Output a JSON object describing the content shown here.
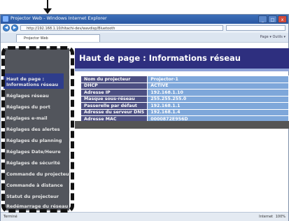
{
  "window": {
    "title": "Projector Web - Windows Internet Explorer",
    "url": "http://192.168.1.10/hitachi-dev/wavdisp/Bluetooth",
    "tab_label": "Projector Web",
    "toolbar_text": "Page ▾  Outils ▾",
    "controls": [
      "_",
      "□",
      "x"
    ]
  },
  "sidebar": {
    "items": [
      {
        "label": "Haut de page :",
        "label2": "Informations réseau",
        "active": true
      },
      {
        "label": "Réglages réseau"
      },
      {
        "label": "Réglages du port"
      },
      {
        "label": "Réglages e-mail"
      },
      {
        "label": "Réglages des alertes"
      },
      {
        "label": "Réglages du planning"
      },
      {
        "label": "Réglages Date/Heure"
      },
      {
        "label": "Réglages de sécurité"
      },
      {
        "label": "Commande du projecteur"
      },
      {
        "label": "Commande à distance"
      },
      {
        "label": "Statut du projecteur"
      },
      {
        "label": "Redémarrage du réseau"
      }
    ]
  },
  "main": {
    "title": "Haut de page : Informations réseau",
    "rows": [
      {
        "label": "Nom du projecteur",
        "value": "Projector-1"
      },
      {
        "label": "DHCP",
        "value": "ACTIVE"
      },
      {
        "label": "Adresse IP",
        "value": "192.168.1.10"
      },
      {
        "label": "Masque sous-réseau",
        "value": "255.255.255.0"
      },
      {
        "label": "Passerelle par défaut",
        "value": "192.168.1.1"
      },
      {
        "label": "Adresse du serveur DNS",
        "value": "192.168.1.4"
      },
      {
        "label": "Adresse MAC",
        "value": "0000872E956D"
      }
    ]
  },
  "status": {
    "left": "Terminé",
    "right": "Internet",
    "zoom": "100%"
  },
  "colors": {
    "header_bg": "#2e2f7f",
    "label_bg": "#4c4f82",
    "value_bg": "#7ea7da",
    "sidebar_bg": "#52555c",
    "active_bg": "#2e3d8c"
  }
}
